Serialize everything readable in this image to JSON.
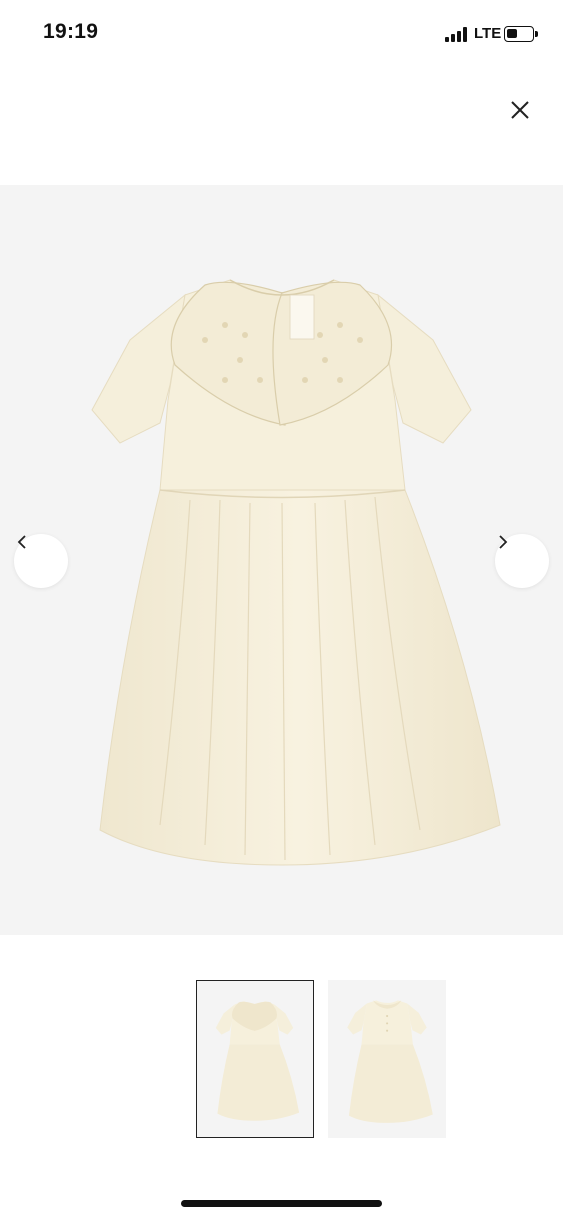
{
  "status_bar": {
    "time": "19:19",
    "network": "LTE",
    "battery_level": 0.45
  },
  "close_button": {
    "icon": "close-icon"
  },
  "gallery": {
    "main_image": {
      "subject": "product-photo-dress-front"
    },
    "prev_icon": "chevron-left-icon",
    "next_icon": "chevron-right-icon",
    "thumbnails": [
      {
        "subject": "product-photo-dress-front",
        "selected": true
      },
      {
        "subject": "product-photo-dress-back",
        "selected": false
      }
    ],
    "dress_color": "#f6f0dc"
  }
}
